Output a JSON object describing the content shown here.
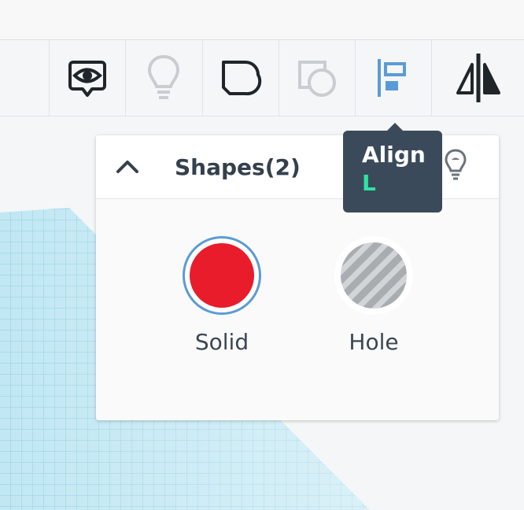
{
  "toolbar": {
    "tools": [
      {
        "name": "show-all",
        "icon": "eye-speech-bubble-icon"
      },
      {
        "name": "notes",
        "icon": "lightbulb-icon",
        "disabled": true
      },
      {
        "name": "group",
        "icon": "group-shapes-icon"
      },
      {
        "name": "ungroup",
        "icon": "ungroup-shapes-icon",
        "disabled": true
      },
      {
        "name": "align",
        "icon": "align-left-icon",
        "active": true
      },
      {
        "name": "mirror",
        "icon": "mirror-icon"
      }
    ]
  },
  "panel": {
    "title": "Shapes(2)",
    "collapse_icon": "chevron-up-icon",
    "shapes": [
      {
        "label": "Solid",
        "color": "#e81c2b",
        "selected": true
      },
      {
        "label": "Hole",
        "pattern": "gray-diagonal-stripes"
      }
    ]
  },
  "tooltip": {
    "title": "Align",
    "shortcut": "L"
  },
  "colors": {
    "accent": "#5b9bd5",
    "solid_red": "#e81c2b",
    "tooltip_bg": "#3b4a5b",
    "shortcut_green": "#2ee6a0",
    "grid_blue": "#b6e2ef"
  }
}
